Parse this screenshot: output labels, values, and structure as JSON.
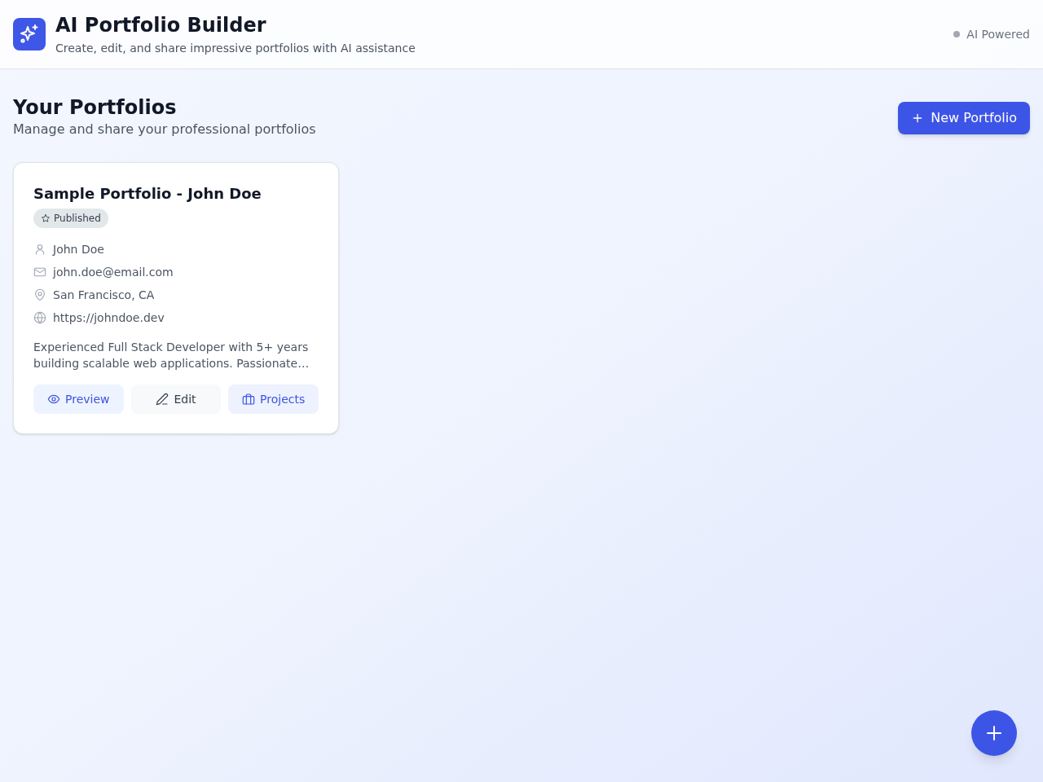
{
  "header": {
    "title": "AI Portfolio Builder",
    "subtitle": "Create, edit, and share impressive portfolios with AI assistance",
    "status_label": "AI Powered"
  },
  "page": {
    "title": "Your Portfolios",
    "subtitle": "Manage and share your professional portfolios",
    "new_button": "New Portfolio"
  },
  "portfolios": [
    {
      "title": "Sample Portfolio - John Doe",
      "badge": "Published",
      "details": [
        {
          "kind": "person",
          "text": "John Doe"
        },
        {
          "kind": "email",
          "text": "john.doe@email.com"
        },
        {
          "kind": "location",
          "text": "San Francisco, CA"
        },
        {
          "kind": "website",
          "text": "https://johndoe.dev"
        }
      ],
      "summary": "Experienced Full Stack Developer with 5+ years building scalable web applications. Passionate…",
      "actions": [
        {
          "kind": "preview",
          "label": "Preview"
        },
        {
          "kind": "edit",
          "label": "Edit"
        },
        {
          "kind": "projects",
          "label": "Projects"
        }
      ]
    }
  ]
}
